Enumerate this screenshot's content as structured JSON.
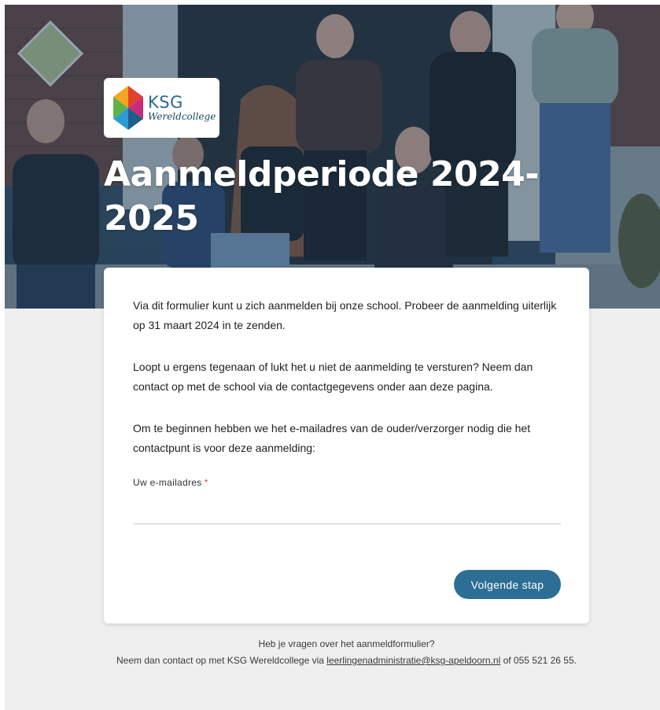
{
  "hero": {
    "logo": {
      "name": "KSG",
      "subtitle": "Wereldcollege"
    },
    "title": "Aanmeldperiode 2024-2025"
  },
  "form": {
    "intro_1": "Via dit formulier kunt u zich aanmelden bij onze school. Probeer de aanmelding uiterlijk op 31 maart 2024 in te zenden.",
    "intro_2": "Loopt u ergens tegenaan of lukt het u niet de aanmelding te versturen? Neem dan contact op met de school via de contactgegevens onder aan deze pagina.",
    "intro_3": "Om te beginnen hebben we het e-mailadres van de ouder/verzorger nodig die het contactpunt is voor deze aanmelding:",
    "email_label": "Uw e-mailadres",
    "required_mark": "*",
    "email_value": "",
    "next_label": "Volgende stap"
  },
  "footer": {
    "line1": "Heb je vragen over het aanmeldformulier?",
    "line2_prefix": "Neem dan contact op met KSG Wereldcollege via ",
    "email_link": "leerlingenadministratie@ksg-apeldoorn.nl",
    "line2_suffix": " of 055 521 26 55."
  },
  "colors": {
    "accent": "#2d6e94",
    "background": "#efefef",
    "required": "#e24b4b"
  }
}
